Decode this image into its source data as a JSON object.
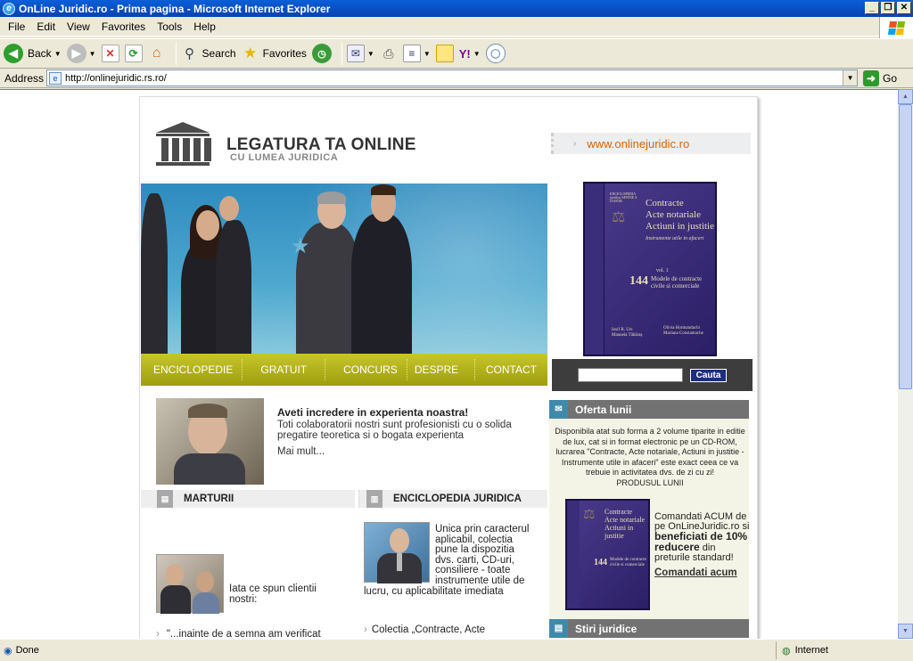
{
  "window": {
    "title": "OnLine Juridic.ro - Prima pagina - Microsoft Internet Explorer"
  },
  "menu": [
    "File",
    "Edit",
    "View",
    "Favorites",
    "Tools",
    "Help"
  ],
  "toolbar": {
    "back": "Back",
    "search": "Search",
    "favorites": "Favorites"
  },
  "address": {
    "label": "Address",
    "url": "http://onlinejuridic.rs.ro/",
    "go": "Go"
  },
  "status": {
    "text": "Done",
    "zone": "Internet"
  },
  "site": {
    "heading": "LEGATURA TA ONLINE",
    "subheading": "CU LUMEA JURIDICA",
    "url_link": "www.onlinejuridic.ro",
    "nav": [
      "ENCICLOPEDIE",
      "GRATUIT",
      "CONCURS",
      "DESPRE NOI",
      "CONTACT"
    ],
    "search_button": "Cauta",
    "book": {
      "top_small": "ENCICLOPEDIA juridica SENTIE A ITATOR",
      "title1": "Contracte",
      "title2": "Acte notariale",
      "title3": "Actiuni in justitie",
      "subtitle": "Instrumente utile in afaceri",
      "vol": "vol. 1",
      "count": "144",
      "models1": "Modele de contracte",
      "models2": "civile si comerciale",
      "author1": "Iosif R. Urs",
      "author2": "Manuela Tăbăraș",
      "author3": "Olivia Hormandachi",
      "author4": "Mariana Constantache"
    },
    "intro": {
      "title": "Aveti incredere in experienta noastra!",
      "text": "Toti colaboratorii nostri sunt profesionisti cu o solida pregatire teoretica si o bogata experienta",
      "more": "Mai mult..."
    },
    "marturii": {
      "title": "MARTURII",
      "text": "Iata ce spun clientii nostri:",
      "quote": "\"...inainte de a semna am verificat"
    },
    "enciclopedia": {
      "title": "ENCICLOPEDIA JURIDICA",
      "text": "Unica prin caracterul aplicabil, colectia pune la dispozitia dvs. carti, CD-uri, consiliere - toate instrumente utile de lucru, cu aplicabilitate imediata",
      "item": "Colectia „Contracte, Acte"
    },
    "offer": {
      "title": "Oferta lunii",
      "text": "Disponibila atat sub forma a 2 volume tiparite in editie de lux, cat si in format electronic pe un CD-ROM, lucrarea \"Contracte, Acte notariale, Actiuni in justitie - Instrumente utile in afaceri\" este exact ceea ce va trebuie in activitatea dvs. de zi cu zi!",
      "product": "PRODUSUL LUNII",
      "order_1": "Comandati ACUM de pe OnLineJuridic.ro si",
      "order_bold": "beneficiati de 10% reducere",
      "order_2": "din preturile standard!",
      "order_link": "Comandati acum"
    },
    "stiri": {
      "title": "Stiri juridice"
    }
  },
  "colors": {
    "title_bar": "#0842b0",
    "nav_olive": "#b1b01b",
    "accent_orange": "#d96400",
    "book_purple": "#2b1f66"
  }
}
